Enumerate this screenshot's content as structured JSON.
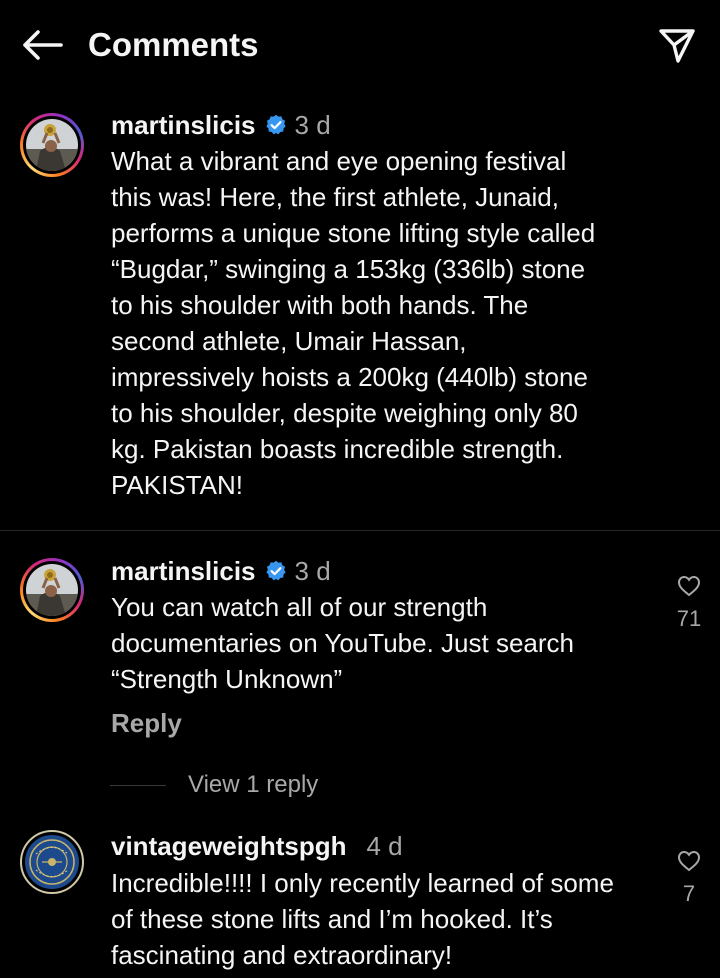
{
  "header": {
    "title": "Comments",
    "back_icon": "arrow-left-icon",
    "share_icon": "paper-plane-icon"
  },
  "caption": {
    "username": "martinslicis",
    "verified": true,
    "time": "3 d",
    "text": "What a vibrant and eye opening festival\nthis was! Here, the first athlete, Junaid,\nperforms a unique stone lifting style called\n“Bugdar,” swinging a 153kg (336lb) stone\nto his shoulder with both hands. The\nsecond athlete, Umair Hassan,\nimpressively hoists a 200kg (440lb) stone\nto his shoulder, despite weighing only 80\nkg. Pakistan boasts incredible strength.\nPAKISTAN!"
  },
  "comments": [
    {
      "username": "martinslicis",
      "verified": true,
      "time": "3 d",
      "text": "You can watch all of our strength\ndocumentaries on YouTube. Just search\n“Strength Unknown”",
      "reply_label": "Reply",
      "likes": "71",
      "view_replies": "View 1 reply"
    },
    {
      "username": "vintageweightspgh",
      "verified": false,
      "time": "4 d",
      "text": "Incredible!!!! I only recently learned of some\nof these stone lifts and I’m hooked. It’s\nfascinating and extraordinary!",
      "likes": "7"
    }
  ],
  "colors": {
    "background": "#000000",
    "primary_text": "#f5f5f5",
    "secondary_text": "#a8a8a8",
    "verified_badge": "#3797f0",
    "divider": "#262626"
  }
}
